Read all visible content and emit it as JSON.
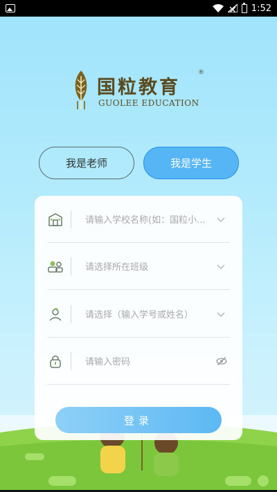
{
  "status_bar": {
    "time": "1:52",
    "icons": [
      "image-icon",
      "wifi-icon",
      "signal-icon",
      "battery-icon"
    ]
  },
  "logo": {
    "chinese_name": "国粒教育",
    "registered_mark": "®",
    "english_name": "GUOLEE EDUCATION"
  },
  "roles": {
    "teacher_label": "我是老师",
    "student_label": "我是学生",
    "selected": "student"
  },
  "form": {
    "school_placeholder": "请输入学校名称(如：国粒小...",
    "class_placeholder": "请选择所在班级",
    "student_placeholder": "请选择（输入学号或姓名）",
    "password_placeholder": "请输入密码",
    "login_label": "登录"
  },
  "colors": {
    "accent": "#55b5f5",
    "background": "#a9e6fb",
    "brand_text": "#5a4a1e"
  }
}
